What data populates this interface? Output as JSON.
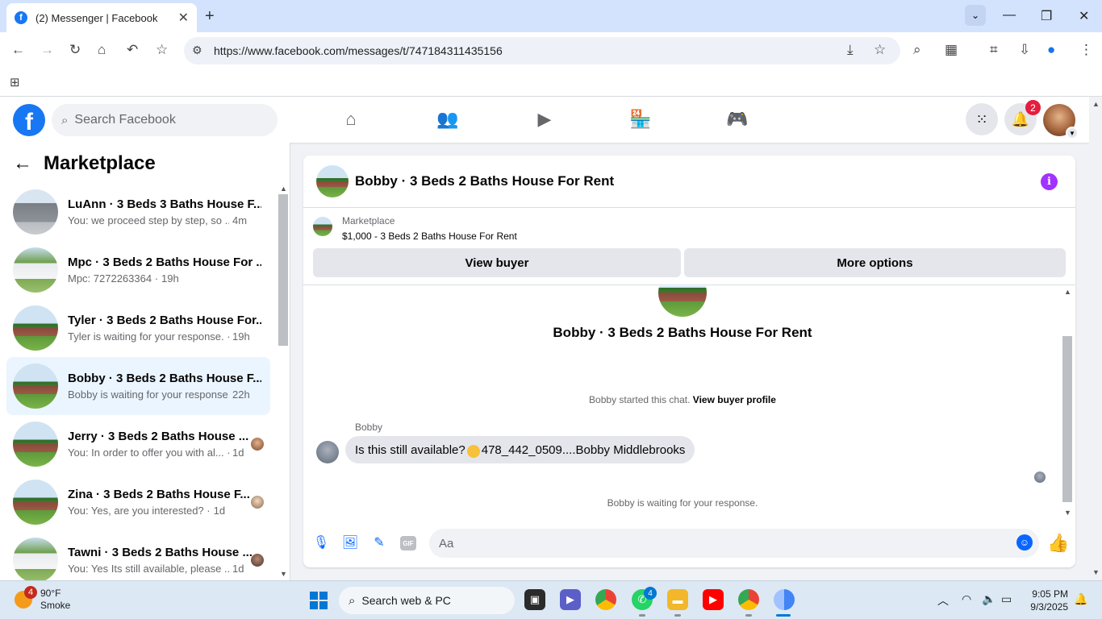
{
  "browser": {
    "tab_title": "(2) Messenger | Facebook",
    "url": "https://www.facebook.com/messages/t/747184311435156"
  },
  "fb": {
    "search_placeholder": "Search Facebook",
    "notifications_count": "2"
  },
  "left": {
    "title": "Marketplace",
    "conversations": [
      {
        "name": "LuAnn · 3 Beds 3 Baths House F...",
        "preview": "You: we proceed step by step, so ...",
        "time": "4m"
      },
      {
        "name": "Mpc · 3 Beds 2 Baths House For ...",
        "preview": "Mpc: 7272263364 ·",
        "time": "19h"
      },
      {
        "name": "Tyler · 3 Beds 2 Baths House For...",
        "preview": "Tyler is waiting for your response. ·",
        "time": "19h"
      },
      {
        "name": "Bobby · 3 Beds 2 Baths House F...",
        "preview": "Bobby is waiting for your response. ·",
        "time": "22h"
      },
      {
        "name": "Jerry · 3 Beds 2 Baths House ...",
        "preview": "You: In order to offer you with al... ·",
        "time": "1d"
      },
      {
        "name": "Zina · 3 Beds 2 Baths House F...",
        "preview": "You: Yes, are you interested? ·",
        "time": "1d"
      },
      {
        "name": "Tawni · 3 Beds 2 Baths House ...",
        "preview": "You: Yes Its still available, please ... ·",
        "time": "1d"
      }
    ]
  },
  "chat": {
    "header_title": "Bobby · 3 Beds 2 Baths House For Rent",
    "listing_label": "Marketplace",
    "listing_detail": "$1,000 - 3 Beds 2 Baths House For Rent",
    "view_buyer": "View buyer",
    "more_options": "More options",
    "center_title": "Bobby · 3 Beds 2 Baths House For Rent",
    "started_text": "Bobby started this chat.",
    "view_buyer_profile": "View buyer profile",
    "sender": "Bobby",
    "message_before_emoji": "Is this still available?",
    "message_after_emoji": "478_442_0509....Bobby Middlebrooks",
    "waiting": "Bobby is waiting for your response.",
    "composer_placeholder": "Aa",
    "gif_label": "GIF"
  },
  "taskbar": {
    "weather_temp": "90°F",
    "weather_cond": "Smoke",
    "weather_badge": "4",
    "search_label": "Search web & PC",
    "whatsapp_badge": "4",
    "time": "9:05 PM",
    "date": "9/3/2025"
  },
  "colors": {
    "facebook_blue": "#1877f2",
    "messenger_blue": "#0866ff",
    "active_conversation_bg": "#ebf5ff",
    "info_purple": "#a033ff",
    "notification_red": "#e41e3f"
  }
}
